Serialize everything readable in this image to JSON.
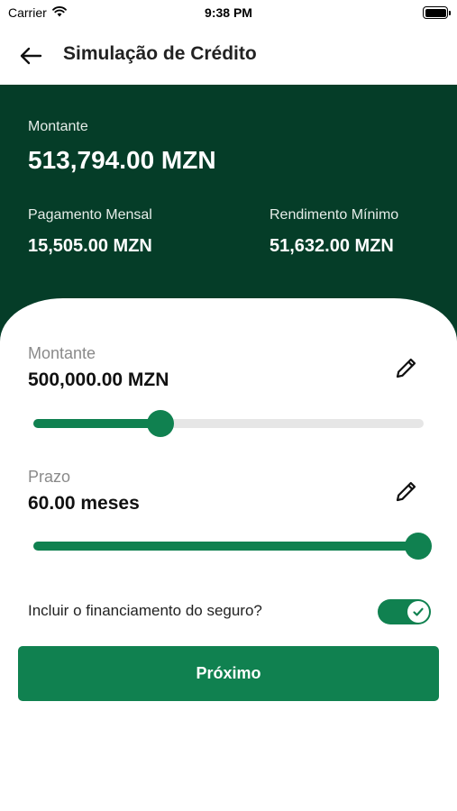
{
  "status_bar": {
    "carrier": "Carrier",
    "time": "9:38 PM"
  },
  "nav": {
    "title": "Simulação de Crédito"
  },
  "summary": {
    "amount_label": "Montante",
    "amount_value": "513,794.00 MZN",
    "monthly_label": "Pagamento Mensal",
    "monthly_value": "15,505.00 MZN",
    "min_income_label": "Rendimento Mínimo",
    "min_income_value": "51,632.00 MZN"
  },
  "form": {
    "amount": {
      "label": "Montante",
      "value": "500,000.00 MZN",
      "slider_fraction": 0.32
    },
    "term": {
      "label": "Prazo",
      "value": "60.00 meses",
      "slider_fraction": 1.0
    },
    "insurance": {
      "label": "Incluir o financiamento do seguro?",
      "checked": true
    },
    "next_label": "Próximo"
  },
  "colors": {
    "header_bg": "#053D28",
    "accent": "#108150",
    "track": "#e6e6e6"
  }
}
